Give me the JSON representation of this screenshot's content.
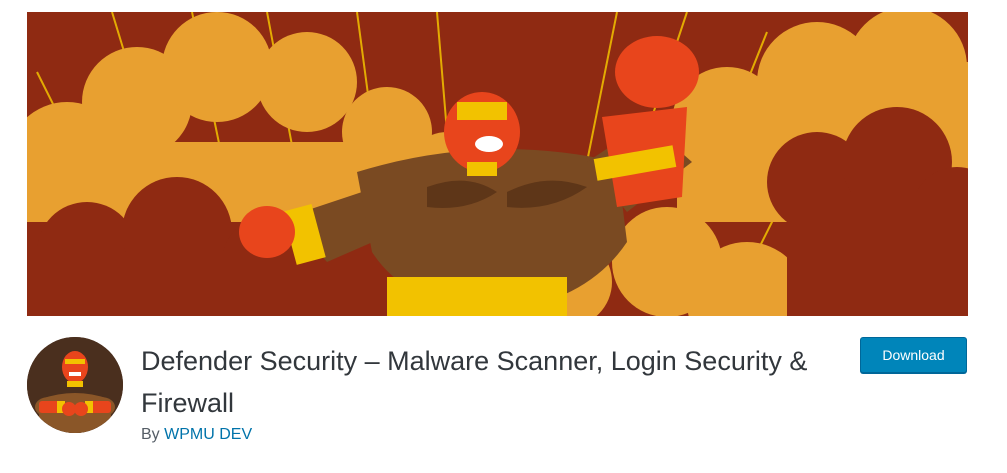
{
  "plugin": {
    "title": "Defender Security – Malware Scanner, Login Security & Firewall",
    "author_prefix": "By",
    "author_name": "WPMU DEV"
  },
  "actions": {
    "download_label": "Download"
  },
  "banner": {
    "depicts": "Cartoon masked wrestler flexing in front of orange clouds",
    "icon": "wrestler-banner-illustration"
  },
  "icon": {
    "depicts": "wrestler-avatar-icon"
  },
  "colors": {
    "banner_background": "#8f2a12",
    "clouds": "#e8a030",
    "mask": "#e8451c",
    "belt": "#f2c200",
    "skin": "#7a4a22",
    "button": "#0085ba",
    "link": "#0073aa",
    "title_text": "#32373c"
  }
}
